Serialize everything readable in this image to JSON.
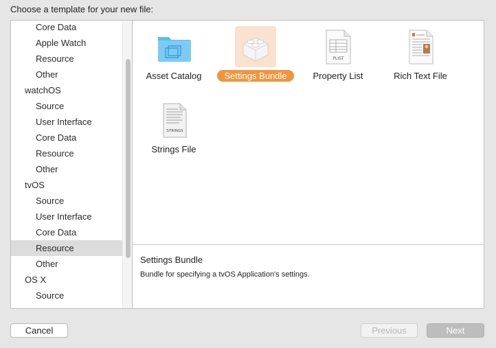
{
  "dialog": {
    "prompt": "Choose a template for your new file:"
  },
  "sidebar": {
    "items": [
      {
        "label": "Core Data",
        "kind": "item",
        "selected": false
      },
      {
        "label": "Apple Watch",
        "kind": "item",
        "selected": false
      },
      {
        "label": "Resource",
        "kind": "item",
        "selected": false
      },
      {
        "label": "Other",
        "kind": "item",
        "selected": false
      },
      {
        "label": "watchOS",
        "kind": "header",
        "selected": false
      },
      {
        "label": "Source",
        "kind": "item",
        "selected": false
      },
      {
        "label": "User Interface",
        "kind": "item",
        "selected": false
      },
      {
        "label": "Core Data",
        "kind": "item",
        "selected": false
      },
      {
        "label": "Resource",
        "kind": "item",
        "selected": false
      },
      {
        "label": "Other",
        "kind": "item",
        "selected": false
      },
      {
        "label": "tvOS",
        "kind": "header",
        "selected": false
      },
      {
        "label": "Source",
        "kind": "item",
        "selected": false
      },
      {
        "label": "User Interface",
        "kind": "item",
        "selected": false
      },
      {
        "label": "Core Data",
        "kind": "item",
        "selected": false
      },
      {
        "label": "Resource",
        "kind": "item",
        "selected": true
      },
      {
        "label": "Other",
        "kind": "item",
        "selected": false
      },
      {
        "label": "OS X",
        "kind": "header",
        "selected": false
      },
      {
        "label": "Source",
        "kind": "item",
        "selected": false
      }
    ]
  },
  "templates": [
    {
      "label": "Asset Catalog",
      "icon": "asset-catalog-folder-icon",
      "selected": false
    },
    {
      "label": "Settings Bundle",
      "icon": "settings-bundle-lego-icon",
      "selected": true
    },
    {
      "label": "Property List",
      "icon": "plist-document-icon",
      "icon_text": "PLIST",
      "selected": false
    },
    {
      "label": "Rich Text File",
      "icon": "rich-text-document-icon",
      "selected": false
    },
    {
      "label": "Strings File",
      "icon": "strings-document-icon",
      "icon_text": "STRINGS",
      "selected": false
    }
  ],
  "description": {
    "title": "Settings Bundle",
    "body": "Bundle for specifying a tvOS Application's settings."
  },
  "buttons": {
    "cancel": "Cancel",
    "previous": "Previous",
    "next": "Next"
  },
  "colors": {
    "selection_accent": "#f0943d",
    "selection_tint": "#f9e2cf",
    "sidebar_selection": "#dcdcdc",
    "folder_blue": "#5bbbf0"
  }
}
